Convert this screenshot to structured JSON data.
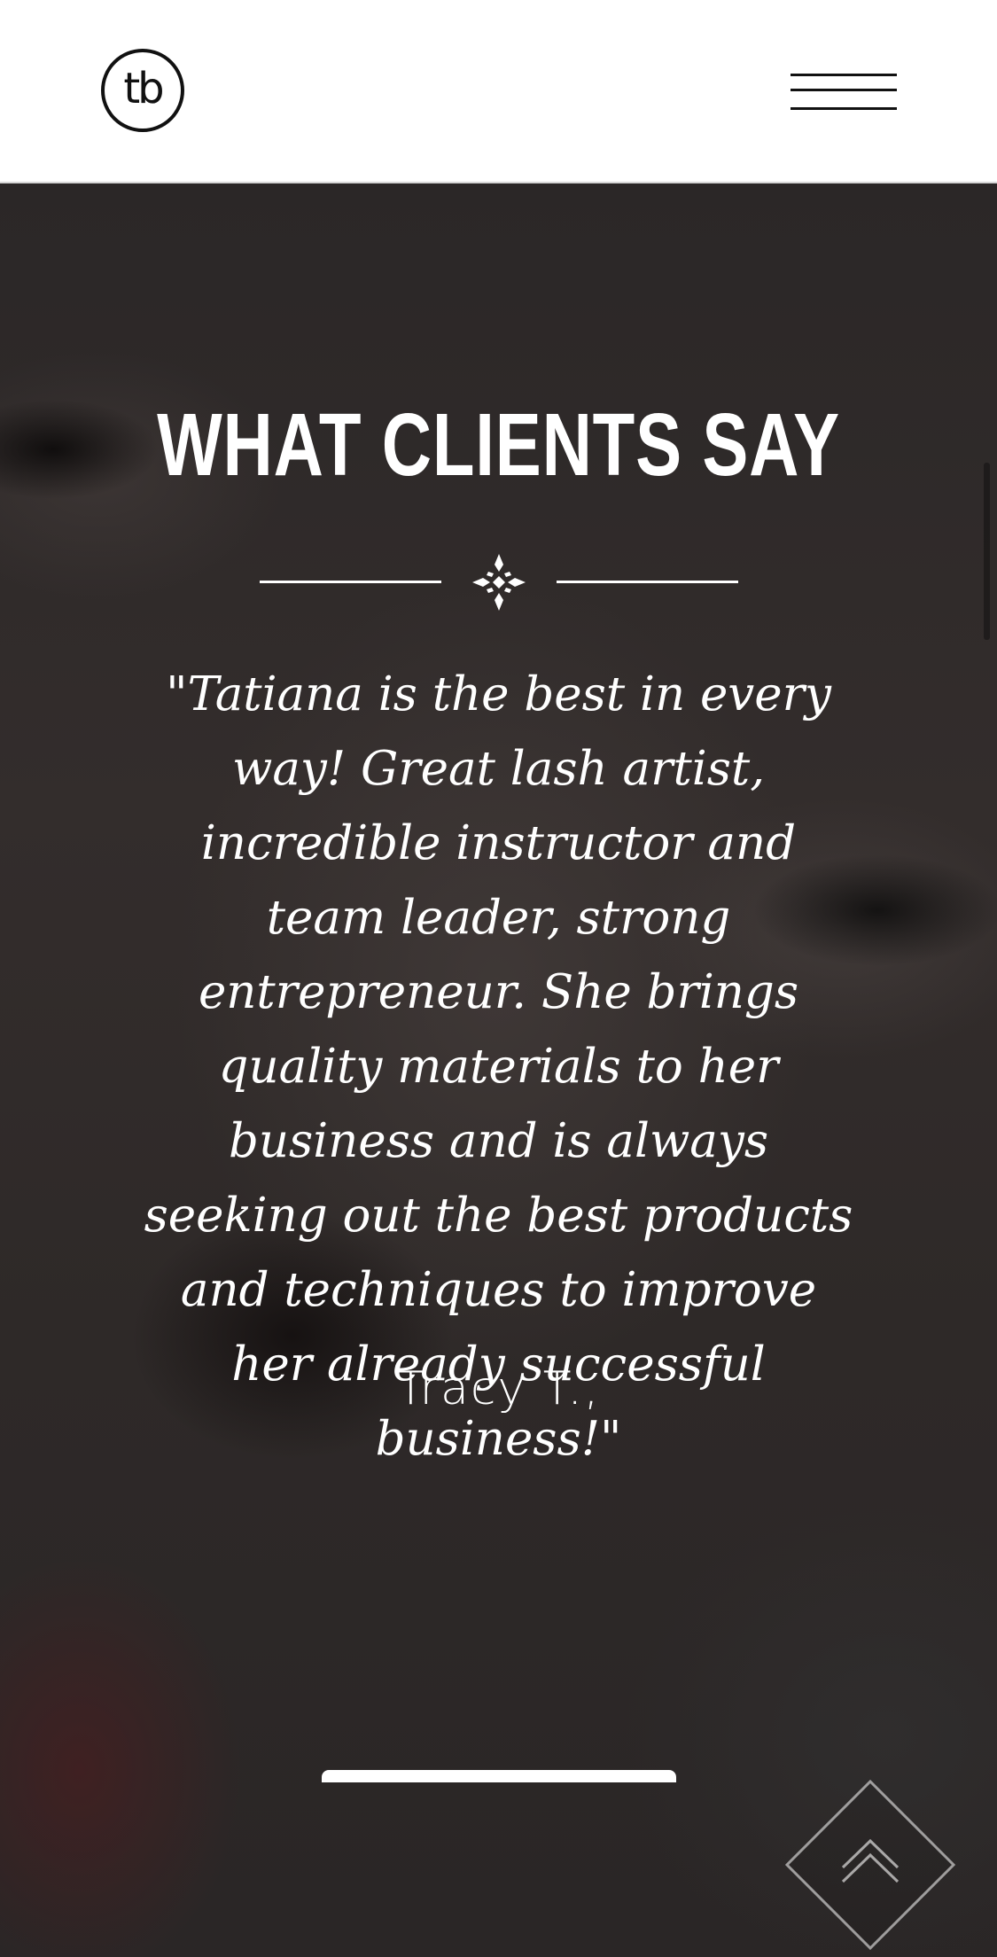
{
  "header": {
    "logo_text": "tb",
    "menu_icon": "hamburger-menu-icon"
  },
  "testimonials": {
    "title": "WHAT CLIENTS SAY",
    "divider_icon": "ornament-diamond-icon",
    "quote": "\"Tatiana is the best in every way! Great lash artist, incredible instructor and team leader, strong entrepreneur. She brings quality materials to her business and is always seeking out the best products and techniques to improve her already successful business!\"",
    "author": "Tracy T.,"
  },
  "scroll_top": {
    "icon": "double-chevron-up-icon"
  },
  "colors": {
    "header_bg": "#ffffff",
    "text": "#ffffff",
    "overlay": "#2a2727"
  }
}
